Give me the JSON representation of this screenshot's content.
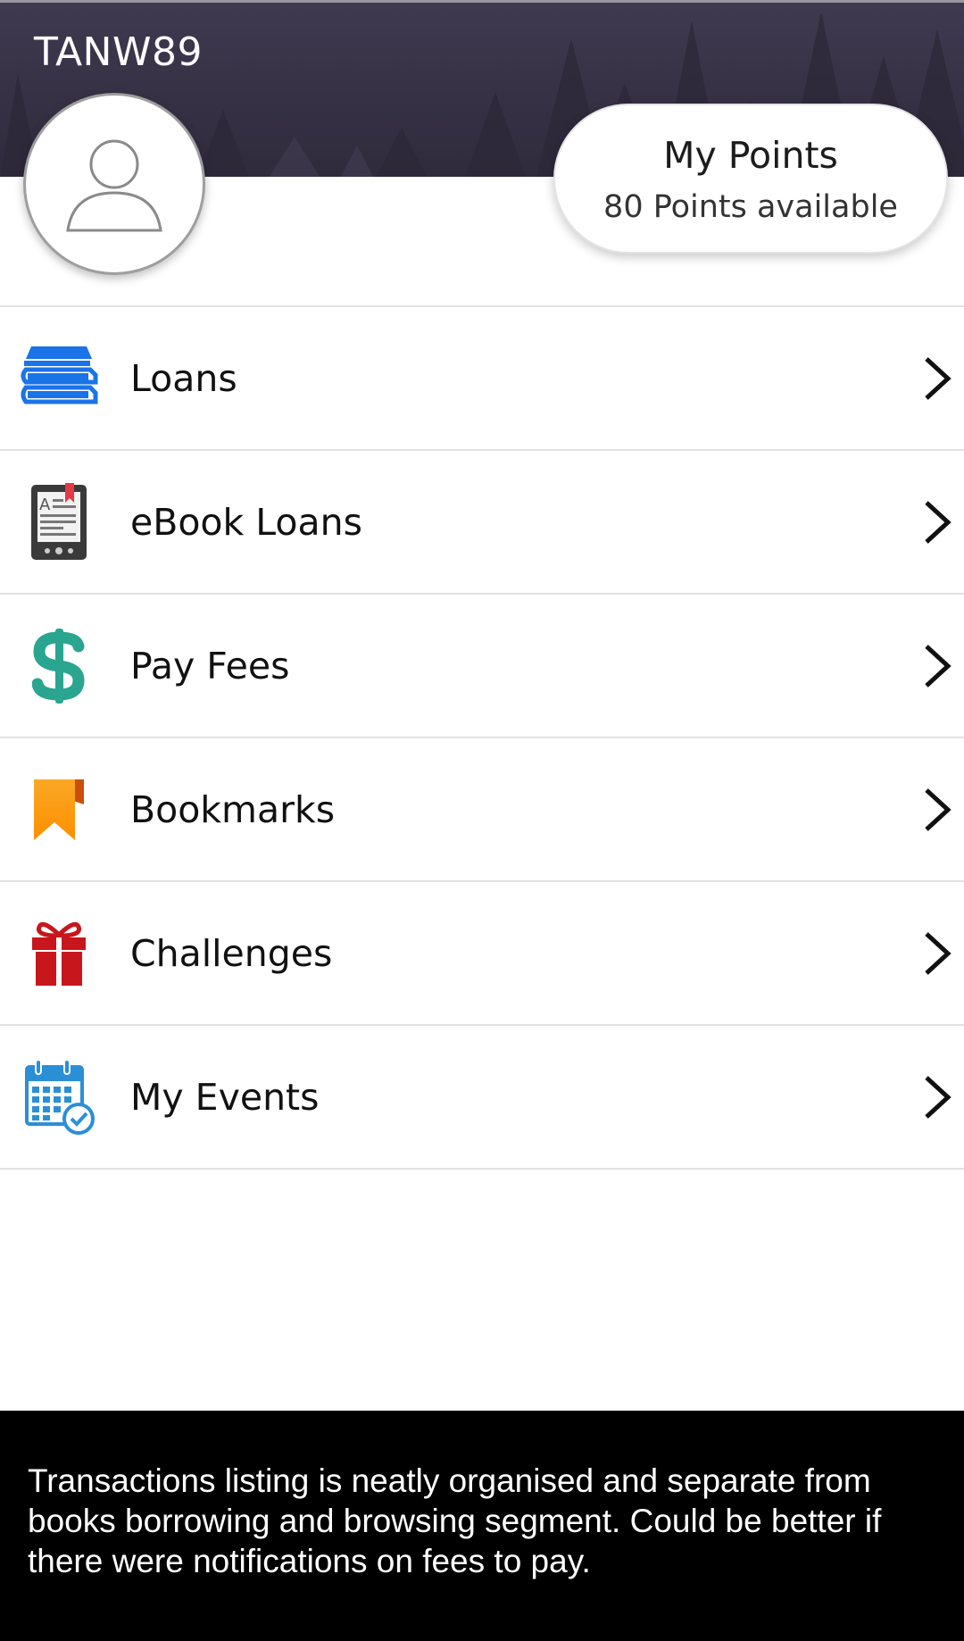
{
  "header": {
    "username": "TANW89"
  },
  "points": {
    "title": "My Points",
    "subtitle": "80 Points available"
  },
  "menu": {
    "items": [
      {
        "label": "Loans",
        "icon": "books-stack-icon"
      },
      {
        "label": "eBook Loans",
        "icon": "ebook-reader-icon"
      },
      {
        "label": "Pay Fees",
        "icon": "dollar-sign-icon"
      },
      {
        "label": "Bookmarks",
        "icon": "bookmark-icon"
      },
      {
        "label": "Challenges",
        "icon": "gift-icon"
      },
      {
        "label": "My Events",
        "icon": "calendar-check-icon"
      }
    ]
  },
  "caption": {
    "text": "Transactions listing is neatly organised and separate from books borrowing and browsing segment. Could be better if there were notifications on fees to pay."
  },
  "colors": {
    "header_bg": "#3a3548",
    "loans_blue": "#1a73e8",
    "fees_teal": "#2aa58f",
    "bookmark_orange": "#f7a21b",
    "gift_red": "#c8161d",
    "calendar_blue": "#2b8fd6"
  }
}
